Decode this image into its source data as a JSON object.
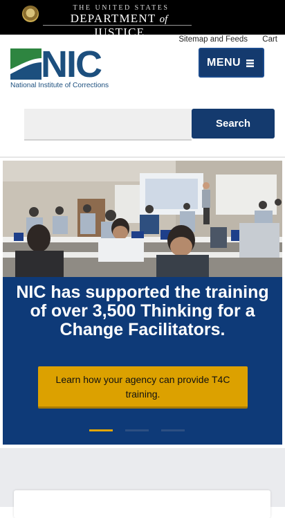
{
  "doj_banner": {
    "line1": "THE UNITED STATES",
    "line2_a": "DEPARTMENT",
    "line2_of": "of",
    "line2_b": "JUSTICE"
  },
  "utility_links": [
    {
      "label": "Sitemap and Feeds"
    },
    {
      "label": "Cart"
    }
  ],
  "logo": {
    "letters": "NIC",
    "tagline": "National Institute of Corrections"
  },
  "menu_button": {
    "label": "MENU"
  },
  "search": {
    "value": "",
    "placeholder": "",
    "button_label": "Search"
  },
  "hero": {
    "title": "NIC has supported the training of over 3,500 Thinking for a Change Facilitators.",
    "cta_label": "Learn how your agency can provide T4C training.",
    "carousel": {
      "total_slides": 3,
      "active_index": 0
    }
  },
  "colors": {
    "brand_navy": "#143a6e",
    "hero_blue": "#0e3a78",
    "cta_gold": "#dca100",
    "logo_green": "#2e8540"
  }
}
